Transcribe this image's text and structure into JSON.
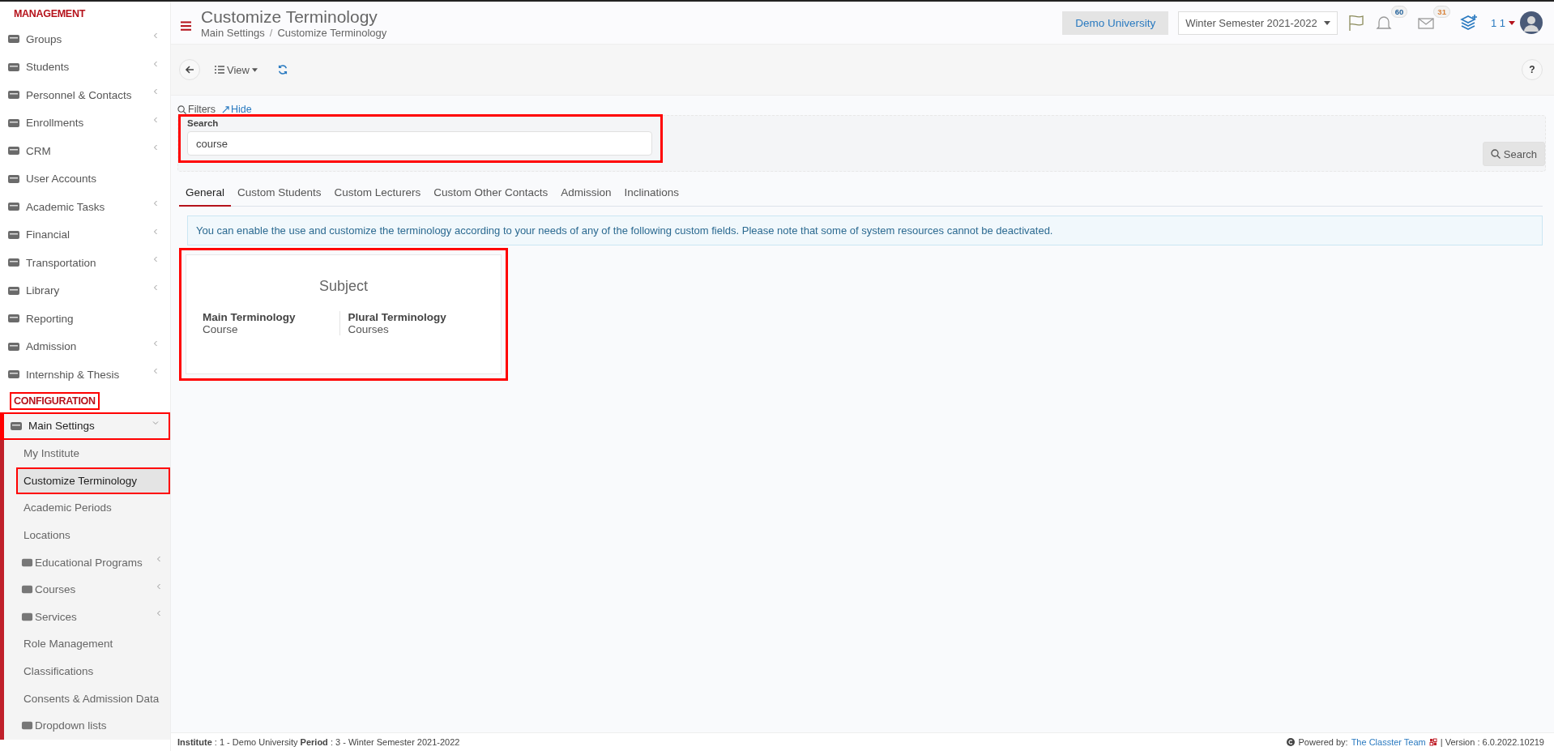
{
  "sidebar": {
    "sections": [
      {
        "title": "MANAGEMENT",
        "highlighted": false,
        "items": [
          {
            "label": "Groups",
            "has_caret": true,
            "highlighted": false
          },
          {
            "label": "Students",
            "has_caret": true,
            "highlighted": false
          },
          {
            "label": "Personnel & Contacts",
            "has_caret": true,
            "highlighted": false
          },
          {
            "label": "Enrollments",
            "has_caret": true,
            "highlighted": false
          },
          {
            "label": "CRM",
            "has_caret": true,
            "highlighted": false
          },
          {
            "label": "User Accounts",
            "has_caret": false,
            "highlighted": false
          },
          {
            "label": "Academic Tasks",
            "has_caret": true,
            "highlighted": false
          },
          {
            "label": "Financial",
            "has_caret": true,
            "highlighted": false
          },
          {
            "label": "Transportation",
            "has_caret": true,
            "highlighted": false
          },
          {
            "label": "Library",
            "has_caret": true,
            "highlighted": false
          },
          {
            "label": "Reporting",
            "has_caret": false,
            "highlighted": false
          },
          {
            "label": "Admission",
            "has_caret": true,
            "highlighted": false
          },
          {
            "label": "Internship & Thesis",
            "has_caret": true,
            "highlighted": false
          }
        ]
      },
      {
        "title": "CONFIGURATION",
        "highlighted": true,
        "items": [
          {
            "label": "Main Settings",
            "has_caret": true,
            "highlighted": true,
            "expanded": true,
            "children": [
              {
                "label": "My Institute",
                "selected": false,
                "has_caret": false,
                "has_icon": false,
                "highlighted": false
              },
              {
                "label": "Customize Terminology",
                "selected": true,
                "has_caret": false,
                "has_icon": false,
                "highlighted": true
              },
              {
                "label": "Academic Periods",
                "selected": false,
                "has_caret": false,
                "has_icon": false,
                "highlighted": false
              },
              {
                "label": "Locations",
                "selected": false,
                "has_caret": false,
                "has_icon": false,
                "highlighted": false
              },
              {
                "label": "Educational Programs",
                "selected": false,
                "has_caret": true,
                "has_icon": true,
                "highlighted": false
              },
              {
                "label": "Courses",
                "selected": false,
                "has_caret": true,
                "has_icon": true,
                "highlighted": false
              },
              {
                "label": "Services",
                "selected": false,
                "has_caret": true,
                "has_icon": true,
                "highlighted": false
              },
              {
                "label": "Role Management",
                "selected": false,
                "has_caret": false,
                "has_icon": false,
                "highlighted": false
              },
              {
                "label": "Classifications",
                "selected": false,
                "has_caret": false,
                "has_icon": false,
                "highlighted": false
              },
              {
                "label": "Consents & Admission Data",
                "selected": false,
                "has_caret": false,
                "has_icon": false,
                "highlighted": false
              },
              {
                "label": "Dropdown lists",
                "selected": false,
                "has_caret": false,
                "has_icon": true,
                "highlighted": false
              }
            ]
          }
        ]
      }
    ]
  },
  "header": {
    "title": "Customize Terminology",
    "breadcrumb": [
      "Main Settings",
      "Customize Terminology"
    ],
    "breadcrumb_separator": "/",
    "institution": "Demo University",
    "period": "Winter Semester 2021-2022",
    "notifications": "60",
    "messages": "31",
    "user": "1 1"
  },
  "toolbar": {
    "view": "View",
    "help": "?"
  },
  "filters": {
    "label": "Filters",
    "hide": "Hide",
    "search_label": "Search",
    "search_value": "course",
    "highlighted": true,
    "search_button": "Search"
  },
  "tabs": [
    {
      "label": "General",
      "selected": true
    },
    {
      "label": "Custom Students",
      "selected": false
    },
    {
      "label": "Custom Lecturers",
      "selected": false
    },
    {
      "label": "Custom Other Contacts",
      "selected": false
    },
    {
      "label": "Admission",
      "selected": false
    },
    {
      "label": "Inclinations",
      "selected": false
    }
  ],
  "info": "You can enable the use and customize the terminology according to your needs of any of the following custom fields. Please note that some of system resources cannot be deactivated.",
  "cards": [
    {
      "title": "Subject",
      "highlighted": true,
      "fields": [
        {
          "label": "Main Terminology",
          "value": "Course"
        },
        {
          "label": "Plural Terminology",
          "value": "Courses"
        }
      ]
    }
  ],
  "footer": {
    "left": "**Institute** : 1 - Demo University **Period** : 3 - Winter Semester 2021-2022",
    "powered": "Powered by:",
    "team": "The Classter Team",
    "version": "| Version : 6.0.2022.10219"
  }
}
